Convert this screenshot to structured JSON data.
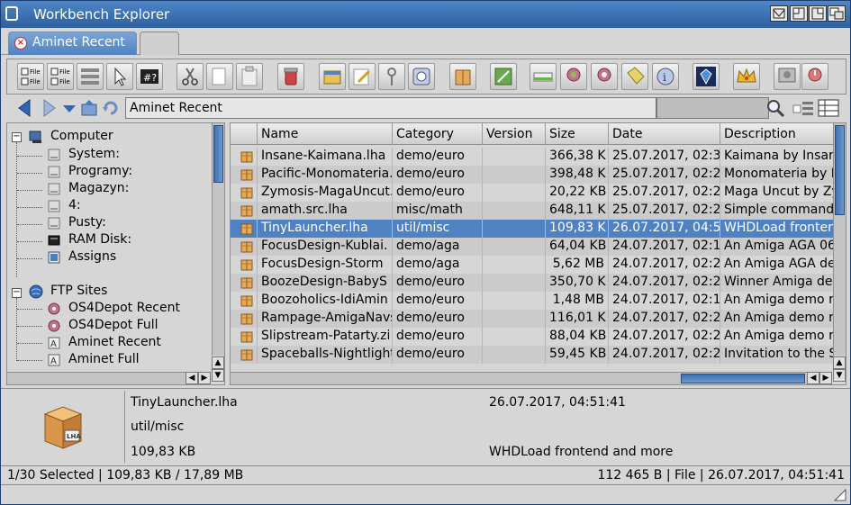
{
  "window": {
    "title": "Workbench Explorer"
  },
  "tabs": [
    {
      "label": "Aminet Recent",
      "active": true
    },
    {
      "label": "",
      "active": false
    }
  ],
  "toolbar": {
    "icons": [
      "file-list-icon",
      "file-list-2-icon",
      "grid-view-icon",
      "pointer-icon",
      "filter-icon",
      "cut-icon",
      "copy-icon",
      "paste-icon",
      "delete-icon",
      "layers-icon",
      "rename-icon",
      "key-icon",
      "info-icon",
      "package-icon",
      "edit-icon",
      "drive-icon",
      "remote-icon",
      "remote-2-icon",
      "tag-icon",
      "about-icon",
      "gem-icon",
      "crown-icon",
      "settings-icon",
      "quit-icon"
    ],
    "small_labels": {
      "file1": "File",
      "file2": "File",
      "file3": "File",
      "file4": "File"
    }
  },
  "address": {
    "path": "Aminet Recent",
    "search_value": ""
  },
  "tree": {
    "groups": [
      {
        "label": "Computer",
        "items": [
          "System:",
          "Programy:",
          "Magazyn:",
          "4:",
          "Pusty:",
          "RAM Disk:",
          "Assigns"
        ]
      },
      {
        "label": "FTP Sites",
        "items": [
          "OS4Depot Recent",
          "OS4Depot Full",
          "Aminet Recent",
          "Aminet Full"
        ]
      }
    ]
  },
  "list": {
    "columns": [
      "Name",
      "Category",
      "Version",
      "Size",
      "Date",
      "Description"
    ],
    "rows": [
      {
        "name": "Insane-Kaimana.lha",
        "category": "demo/euro",
        "version": "",
        "size": "366,38 K",
        "date": "25.07.2017, 02:3",
        "desc": "Kaimana by Insar"
      },
      {
        "name": "Pacific-Monomateria.l",
        "category": "demo/euro",
        "version": "",
        "size": "398,48 K",
        "date": "25.07.2017, 02:2",
        "desc": "Monomateria by F"
      },
      {
        "name": "Zymosis-MagaUncut.",
        "category": "demo/euro",
        "version": "",
        "size": "20,22 KB",
        "date": "25.07.2017, 02:2",
        "desc": "Maga Uncut by Zy"
      },
      {
        "name": "amath.src.lha",
        "category": "misc/math",
        "version": "",
        "size": "648,11 K",
        "date": "25.07.2017, 02:2",
        "desc": "Simple command"
      },
      {
        "name": "TinyLauncher.lha",
        "category": "util/misc",
        "version": "",
        "size": "109,83 K",
        "date": "26.07.2017, 04:5",
        "desc": "WHDLoad fronter"
      },
      {
        "name": "FocusDesign-Kublai.",
        "category": "demo/aga",
        "version": "",
        "size": "64,04 KB",
        "date": "24.07.2017, 02:1",
        "desc": "An Amiga AGA 06"
      },
      {
        "name": "FocusDesign-Storm",
        "category": "demo/aga",
        "version": "",
        "size": "5,62 MB",
        "date": "24.07.2017, 02:2",
        "desc": "An Amiga AGA de"
      },
      {
        "name": "BoozeDesign-BabyS",
        "category": "demo/euro",
        "version": "",
        "size": "350,70 K",
        "date": "24.07.2017, 02:2",
        "desc": "Winner Amiga de"
      },
      {
        "name": "Boozoholics-IdiAmin",
        "category": "demo/euro",
        "version": "",
        "size": "1,48 MB",
        "date": "24.07.2017, 02:1",
        "desc": "An Amiga demo r"
      },
      {
        "name": "Rampage-AmigaNavs",
        "category": "demo/euro",
        "version": "",
        "size": "116,01 K",
        "date": "24.07.2017, 02:2",
        "desc": "An Amiga demo r"
      },
      {
        "name": "Slipstream-Patarty.zi",
        "category": "demo/euro",
        "version": "",
        "size": "88,04 KB",
        "date": "24.07.2017, 02:2",
        "desc": "An Amiga demo r"
      },
      {
        "name": "Spaceballs-Nightlight",
        "category": "demo/euro",
        "version": "",
        "size": "59,45 KB",
        "date": "24.07.2017, 02:2",
        "desc": "Invitation to the S"
      }
    ],
    "selected_index": 4
  },
  "info": {
    "name": "TinyLauncher.lha",
    "category": "util/misc",
    "size": "109,83 KB",
    "date": "26.07.2017, 04:51:41",
    "description": "WHDLoad frontend and more",
    "icon_label": "LHA"
  },
  "status": {
    "left": "1/30 Selected | 109,83 KB / 17,89 MB",
    "right": "112 465 B | File | 26.07.2017, 04:51:41"
  },
  "colors": {
    "titlebar": "#2c5f9e",
    "selection": "#4f82c2",
    "panel": "#d6d6d6"
  }
}
